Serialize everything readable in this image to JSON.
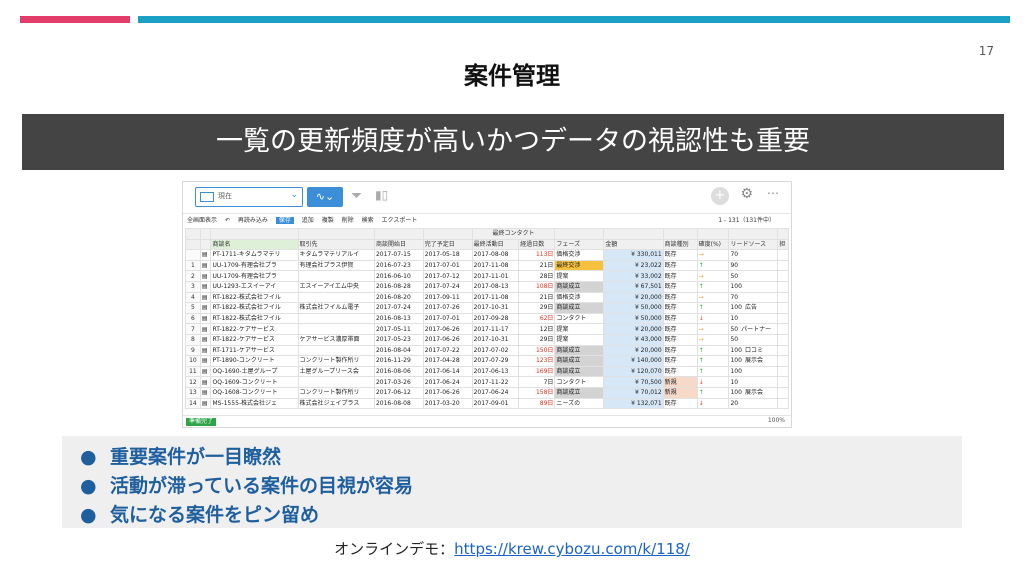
{
  "slide": {
    "number": "17",
    "title": "案件管理",
    "banner": "一覧の更新頻度が高いかつデータの視認性も重要",
    "bullets": [
      "重要案件が一目瞭然",
      "活動が滞っている案件の目視が容易",
      "気になる案件をピン留め"
    ],
    "demo_label": "オンラインデモ：",
    "demo_link": "https://krew.cybozu.com/k/118/",
    "colors": {
      "red_bar": "#e23d6a",
      "blue_bar": "#1b9fc5",
      "banner_bg": "#444444",
      "bullet_text": "#1f5f9e"
    }
  },
  "app": {
    "view_select": "現在",
    "toolbar": [
      "全画面表示",
      "再読み込み",
      "保存",
      "追加",
      "複製",
      "削除",
      "検索",
      "エクスポート"
    ],
    "count": "1 - 131（131件中）",
    "group_header": "最終コンタクト",
    "columns": [
      "商談名",
      "取引先",
      "商談開始日",
      "完了予定日",
      "最終活動日",
      "経過日数",
      "フェーズ",
      "金額",
      "商談種別",
      "確度(%)",
      "リードソース",
      "担"
    ],
    "rows": [
      {
        "idx": "",
        "name": "PT-1711-キタムラマテリ",
        "client": "キタムラマテリアルイ",
        "start": "2017-07-15",
        "end": "2017-05-18",
        "last": "2017-08-08",
        "days": "113日",
        "phase": "価格交渉",
        "amount": "¥ 330,011",
        "type": "既存",
        "dir": "→",
        "prob": "70",
        "lead": ""
      },
      {
        "idx": "1",
        "name": "UU-1709-有理会社プラ",
        "client": "有理会社プラス伊賀",
        "start": "2016-07-23",
        "end": "2017-07-01",
        "last": "2017-11-08",
        "days": "21日",
        "phase": "最終交渉",
        "amount": "¥ 23,022",
        "type": "既存",
        "dir": "↑",
        "prob": "90",
        "lead": ""
      },
      {
        "idx": "2",
        "name": "UU-1709-有理会社プラ",
        "client": "",
        "start": "2016-06-10",
        "end": "2017-07-12",
        "last": "2017-11-01",
        "days": "28日",
        "phase": "提案",
        "amount": "¥ 33,002",
        "type": "既存",
        "dir": "→",
        "prob": "50",
        "lead": ""
      },
      {
        "idx": "3",
        "name": "UU-1293-エスイーアイ",
        "client": "エスイーアイエム中央",
        "start": "2016-08-28",
        "end": "2017-07-24",
        "last": "2017-08-13",
        "days": "108日",
        "phase": "商談成立",
        "amount": "¥ 67,501",
        "type": "既存",
        "dir": "↑",
        "prob": "100",
        "lead": ""
      },
      {
        "idx": "4",
        "name": "RT-1822-株式会社フイル",
        "client": "",
        "start": "2016-08-20",
        "end": "2017-09-11",
        "last": "2017-11-08",
        "days": "21日",
        "phase": "価格交渉",
        "amount": "¥ 20,000",
        "type": "既存",
        "dir": "→",
        "prob": "70",
        "lead": ""
      },
      {
        "idx": "5",
        "name": "RT-1822-株式会社フイル",
        "client": "株式会社フイルム電子",
        "start": "2017-07-24",
        "end": "2017-07-26",
        "last": "2017-10-31",
        "days": "29日",
        "phase": "商談成立",
        "amount": "¥ 50,000",
        "type": "既存",
        "dir": "↑",
        "prob": "100",
        "lead": "広告"
      },
      {
        "idx": "6",
        "name": "RT-1822-株式会社フイル",
        "client": "",
        "start": "2016-08-13",
        "end": "2017-07-01",
        "last": "2017-09-28",
        "days": "62日",
        "phase": "コンタクト",
        "amount": "¥ 50,000",
        "type": "既存",
        "dir": "↓",
        "prob": "10",
        "lead": ""
      },
      {
        "idx": "7",
        "name": "RT-1822-ケアサービス",
        "client": "",
        "start": "2017-05-11",
        "end": "2017-06-26",
        "last": "2017-11-17",
        "days": "12日",
        "phase": "提案",
        "amount": "¥ 20,000",
        "type": "既存",
        "dir": "→",
        "prob": "50",
        "lead": "パートナー"
      },
      {
        "idx": "8",
        "name": "RT-1822-ケアサービス",
        "client": "ケアサービス濃厚帯面",
        "start": "2017-05-23",
        "end": "2017-06-26",
        "last": "2017-10-31",
        "days": "29日",
        "phase": "提案",
        "amount": "¥ 43,000",
        "type": "既存",
        "dir": "→",
        "prob": "50",
        "lead": ""
      },
      {
        "idx": "9",
        "name": "RT-1711-ケアサービス",
        "client": "",
        "start": "2016-08-04",
        "end": "2017-07-22",
        "last": "2017-07-02",
        "days": "150日",
        "phase": "商談成立",
        "amount": "¥ 20,000",
        "type": "既存",
        "dir": "↑",
        "prob": "100",
        "lead": "口コミ"
      },
      {
        "idx": "10",
        "name": "PT-1890-コンクリート",
        "client": "コンクリート製作所リ",
        "start": "2016-11-29",
        "end": "2017-04-28",
        "last": "2017-07-29",
        "days": "123日",
        "phase": "商談成立",
        "amount": "¥ 140,000",
        "type": "既存",
        "dir": "↑",
        "prob": "100",
        "lead": "展示会"
      },
      {
        "idx": "11",
        "name": "OQ-1690-土屋グループ",
        "client": "土屋グループリース会",
        "start": "2016-08-06",
        "end": "2017-06-14",
        "last": "2017-06-13",
        "days": "169日",
        "phase": "商談成立",
        "amount": "¥ 120,070",
        "type": "既存",
        "dir": "↑",
        "prob": "100",
        "lead": ""
      },
      {
        "idx": "12",
        "name": "OQ-1609-コンクリート",
        "client": "",
        "start": "2017-03-26",
        "end": "2017-06-24",
        "last": "2017-11-22",
        "days": "7日",
        "phase": "コンタクト",
        "amount": "¥ 70,500",
        "type": "新規",
        "dir": "↓",
        "prob": "10",
        "lead": ""
      },
      {
        "idx": "13",
        "name": "OQ-1608-コンクリート",
        "client": "コンクリート製作所リ",
        "start": "2017-06-12",
        "end": "2017-06-26",
        "last": "2017-06-24",
        "days": "158日",
        "phase": "商談成立",
        "amount": "¥ 70,012",
        "type": "新規",
        "dir": "↑",
        "prob": "100",
        "lead": "展示会"
      },
      {
        "idx": "14",
        "name": "MS-1555-株式会社ジェ",
        "client": "株式会社ジェイプラス",
        "start": "2016-08-08",
        "end": "2017-03-20",
        "last": "2017-09-01",
        "days": "89日",
        "phase": "ニーズの",
        "amount": "¥ 132,071",
        "type": "既存",
        "dir": "↓",
        "prob": "20",
        "lead": ""
      }
    ],
    "bottom_button": "準備完了",
    "zoom": "100%"
  }
}
